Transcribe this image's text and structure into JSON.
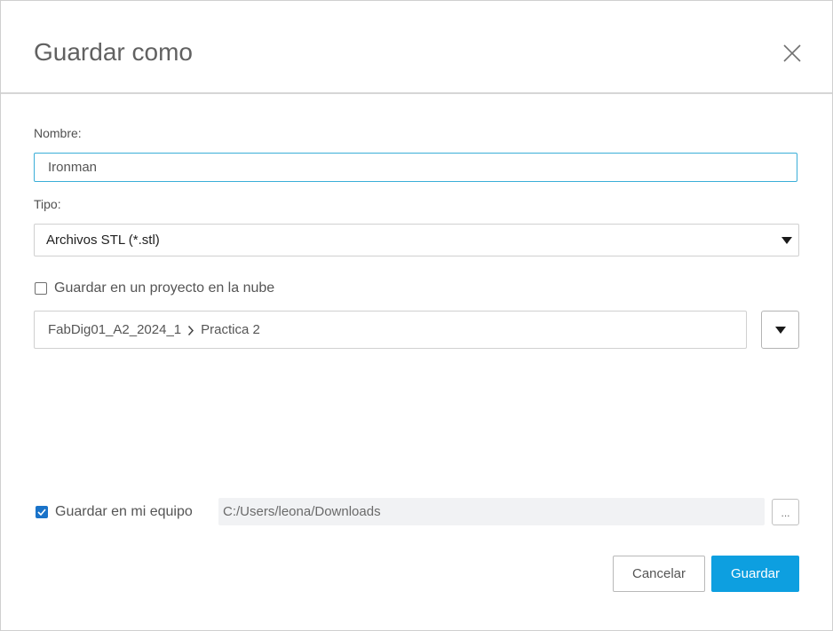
{
  "dialog": {
    "title": "Guardar como"
  },
  "name_field": {
    "label": "Nombre:",
    "value": "Ironman"
  },
  "type_field": {
    "label": "Tipo:",
    "selected": "Archivos STL (*.stl)"
  },
  "cloud": {
    "checkbox_label": "Guardar en un proyecto en la nube",
    "checked": false,
    "breadcrumb": [
      "FabDig01_A2_2024_1",
      "Practica 2"
    ]
  },
  "local": {
    "checkbox_label": "Guardar en mi equipo",
    "checked": true,
    "path": "C:/Users/leona/Downloads",
    "browse_label": "..."
  },
  "buttons": {
    "cancel": "Cancelar",
    "save": "Guardar"
  },
  "colors": {
    "accent": "#0d9fe0",
    "input_focus_border": "#3aaed8",
    "checkbox_checked": "#1a73c9"
  },
  "icons": {
    "close": "close-icon",
    "select_arrow": "caret-down-icon",
    "breadcrumb_sep": "chevron-right-icon",
    "dropdown": "caret-down-icon",
    "check": "check-icon"
  }
}
